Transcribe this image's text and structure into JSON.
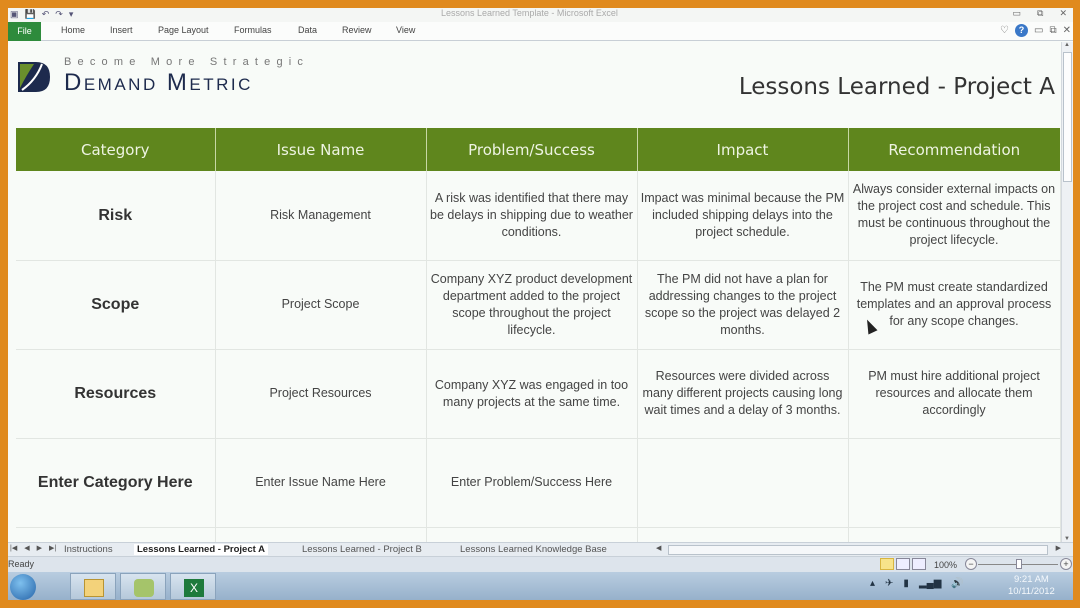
{
  "window": {
    "title": "Lessons Learned Template - Microsoft Excel",
    "controls": [
      "minimize",
      "restore",
      "close"
    ]
  },
  "ribbon": {
    "file_label": "File",
    "tabs": [
      "Home",
      "Insert",
      "Page Layout",
      "Formulas",
      "Data",
      "Review",
      "View"
    ]
  },
  "logo": {
    "tagline": "Become More Strategic",
    "brand": "Demand Metric"
  },
  "sheet": {
    "title": "Lessons Learned - Project A",
    "headers": [
      "Category",
      "Issue Name",
      "Problem/Success",
      "Impact",
      "Recommendation"
    ],
    "rows": [
      {
        "category": "Risk",
        "issue": "Risk Management",
        "problem": "A risk was identified that there may be delays in shipping due to weather conditions.",
        "impact": "Impact was minimal because the PM included shipping delays into the project schedule.",
        "recommendation": "Always consider external impacts on the project cost and schedule. This must be continuous throughout the project lifecycle."
      },
      {
        "category": "Scope",
        "issue": "Project Scope",
        "problem": "Company XYZ product development department added to the project scope throughout the project lifecycle.",
        "impact": "The PM did not have a plan for addressing changes to the project scope so the project was delayed 2 months.",
        "recommendation": "The PM must create standardized templates and an approval process for any scope changes."
      },
      {
        "category": "Resources",
        "issue": "Project Resources",
        "problem": "Company XYZ was engaged in too many projects at the same time.",
        "impact": "Resources were divided across many different projects causing long wait times and a delay of 3 months.",
        "recommendation": "PM must hire additional project resources and allocate them accordingly"
      },
      {
        "category": "Enter Category Here",
        "issue": "Enter Issue Name Here",
        "problem": "Enter Problem/Success Here",
        "impact": "",
        "recommendation": ""
      }
    ]
  },
  "sheet_tabs": {
    "tabs": [
      "Instructions",
      "Lessons Learned - Project A",
      "Lessons Learned - Project B",
      "Lessons Learned Knowledge Base"
    ],
    "active": "Lessons Learned - Project A"
  },
  "status": {
    "ready": "Ready",
    "zoom": "100%"
  },
  "taskbar": {
    "time": "9:21 AM",
    "date": "10/11/2012"
  },
  "colors": {
    "header_green": "#5f861d",
    "brand_navy": "#1d2a4d",
    "frame_orange": "#e08a1e"
  }
}
